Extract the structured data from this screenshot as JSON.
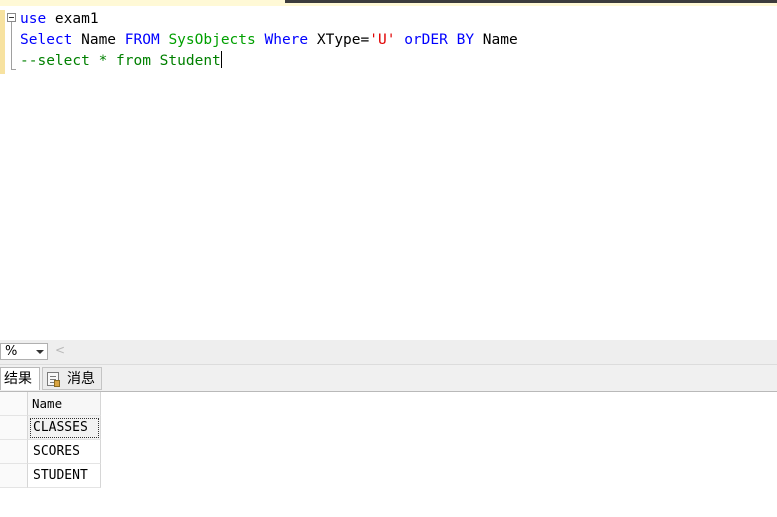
{
  "editor": {
    "lines": [
      {
        "parts": [
          {
            "t": "use",
            "cls": "kw"
          },
          {
            "t": " exam1",
            "cls": ""
          }
        ]
      },
      {
        "parts": [
          {
            "t": "Select",
            "cls": "kw"
          },
          {
            "t": " Name ",
            "cls": ""
          },
          {
            "t": "FROM",
            "cls": "kw"
          },
          {
            "t": " ",
            "cls": ""
          },
          {
            "t": "SysObjects",
            "cls": "obj"
          },
          {
            "t": " ",
            "cls": ""
          },
          {
            "t": "Where",
            "cls": "kw"
          },
          {
            "t": " XType",
            "cls": ""
          },
          {
            "t": "=",
            "cls": ""
          },
          {
            "t": "'U'",
            "cls": "str"
          },
          {
            "t": " ",
            "cls": ""
          },
          {
            "t": "orDER",
            "cls": "kw"
          },
          {
            "t": " ",
            "cls": ""
          },
          {
            "t": "BY",
            "cls": "kw"
          },
          {
            "t": " Name",
            "cls": ""
          }
        ]
      },
      {
        "parts": [
          {
            "t": "--select * from Student",
            "cls": "cmt"
          }
        ],
        "caret": true
      }
    ]
  },
  "zoom": {
    "value": "%"
  },
  "tabs": {
    "results_label": "结果",
    "messages_label": "消息"
  },
  "grid": {
    "columns": [
      "Name"
    ],
    "rows": [
      [
        "CLASSES"
      ],
      [
        "SCORES"
      ],
      [
        "STUDENT"
      ]
    ],
    "selected_row": 0
  },
  "icons": {
    "fold": "collapse-minus-icon",
    "zoom_dropdown": "chevron-down-icon",
    "scroll": "scroll-left-icon",
    "messages": "messages-icon"
  }
}
